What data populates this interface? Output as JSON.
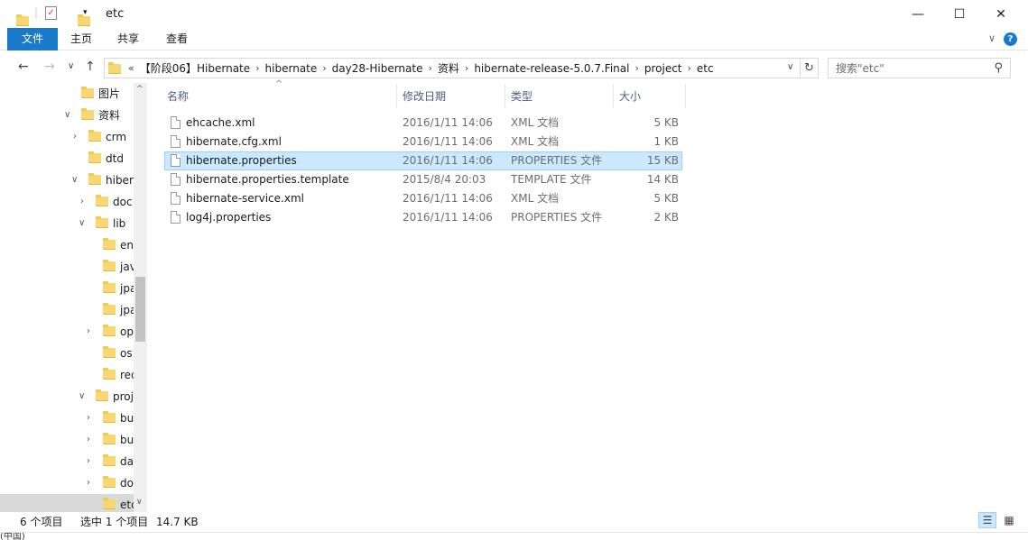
{
  "window": {
    "title": "etc",
    "minimize": "—",
    "maximize": "☐",
    "close": "✕"
  },
  "ribbon": {
    "tabs": [
      {
        "label": "文件"
      },
      {
        "label": "主页"
      },
      {
        "label": "共享"
      },
      {
        "label": "查看"
      }
    ],
    "collapse": "∨",
    "help": "?"
  },
  "nav": {
    "back": "←",
    "forward": "→",
    "recent": "∨",
    "up": "↑"
  },
  "address": {
    "overflow": "«",
    "crumbs": [
      "【阶段06】Hibernate",
      "hibernate",
      "day28-Hibernate",
      "资料",
      "hibernate-release-5.0.7.Final",
      "project",
      "etc"
    ],
    "separator": "›",
    "dropdown": "∨",
    "refresh": "↻"
  },
  "search": {
    "placeholder": "搜索\"etc\"",
    "icon": "search-icon"
  },
  "tree": {
    "items": [
      {
        "label": "图片",
        "chevron": ""
      },
      {
        "label": "资料",
        "chevron": "∨"
      },
      {
        "label": "crm",
        "chevron": "›"
      },
      {
        "label": "dtd",
        "chevron": ""
      },
      {
        "label": "hiber",
        "chevron": "∨"
      },
      {
        "label": "doc",
        "chevron": "›"
      },
      {
        "label": "lib",
        "chevron": "∨"
      },
      {
        "label": "en",
        "chevron": ""
      },
      {
        "label": "jav",
        "chevron": ""
      },
      {
        "label": "jpa",
        "chevron": ""
      },
      {
        "label": "jpa",
        "chevron": ""
      },
      {
        "label": "op",
        "chevron": "›"
      },
      {
        "label": "os",
        "chevron": ""
      },
      {
        "label": "rec",
        "chevron": ""
      },
      {
        "label": "proj",
        "chevron": "∨"
      },
      {
        "label": "bu",
        "chevron": "›"
      },
      {
        "label": "bu",
        "chevron": "›"
      },
      {
        "label": "da",
        "chevron": "›"
      },
      {
        "label": "do",
        "chevron": "›"
      },
      {
        "label": "etc",
        "chevron": ""
      }
    ],
    "scroll_up": "^",
    "scroll_down": "∨"
  },
  "files": {
    "columns": {
      "name": "名称",
      "date": "修改日期",
      "type": "类型",
      "size": "大小"
    },
    "sort_arrow": "^",
    "rows": [
      {
        "name": "ehcache.xml",
        "date": "2016/1/11 14:06",
        "type": "XML 文档",
        "size": "5 KB"
      },
      {
        "name": "hibernate.cfg.xml",
        "date": "2016/1/11 14:06",
        "type": "XML 文档",
        "size": "1 KB"
      },
      {
        "name": "hibernate.properties",
        "date": "2016/1/11 14:06",
        "type": "PROPERTIES 文件",
        "size": "15 KB"
      },
      {
        "name": "hibernate.properties.template",
        "date": "2015/8/4 20:03",
        "type": "TEMPLATE 文件",
        "size": "14 KB"
      },
      {
        "name": "hibernate-service.xml",
        "date": "2016/1/11 14:06",
        "type": "XML 文档",
        "size": "5 KB"
      },
      {
        "name": "log4j.properties",
        "date": "2016/1/11 14:06",
        "type": "PROPERTIES 文件",
        "size": "2 KB"
      }
    ]
  },
  "status": {
    "count": "6 个项目",
    "selected": "选中 1 个项目",
    "selected_size": "14.7 KB"
  },
  "bottom": {
    "text": "(中国)"
  }
}
